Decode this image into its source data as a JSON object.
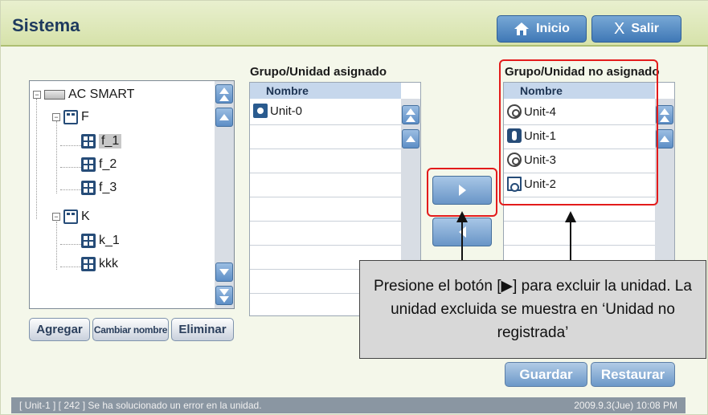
{
  "header": {
    "title": "Sistema",
    "home_label": "Inicio",
    "exit_label": "Salir",
    "exit_glyph": "X"
  },
  "tree": {
    "root": "AC SMART",
    "groups": [
      {
        "name": "F",
        "units": [
          "f_1",
          "f_2",
          "f_3"
        ]
      },
      {
        "name": "K",
        "units": [
          "k_1",
          "kkk"
        ]
      }
    ],
    "selected": "f_1"
  },
  "tree_buttons": {
    "add": "Agregar",
    "rename": "Cambiar nombre",
    "delete": "Eliminar"
  },
  "assigned": {
    "title": "Grupo/Unidad asignado",
    "column": "Nombre",
    "items": [
      {
        "name": "Unit-0",
        "icon": "home-unit-icon"
      }
    ]
  },
  "unassigned": {
    "title": "Grupo/Unidad no asignado",
    "column": "Nombre",
    "items": [
      {
        "name": "Unit-4",
        "icon": "gear-unit-icon"
      },
      {
        "name": "Unit-1",
        "icon": "cassette-unit-icon"
      },
      {
        "name": "Unit-3",
        "icon": "gear-unit-icon"
      },
      {
        "name": "Unit-2",
        "icon": "duct-unit-icon"
      }
    ]
  },
  "callout": {
    "text": "Presione el botón [▶] para excluir la unidad. La unidad excluida se muestra en ‘Unidad no registrada’"
  },
  "actions": {
    "save": "Guardar",
    "restore": "Restaurar"
  },
  "status": {
    "message": "[ Unit-1 ] [ 242 ] Se ha solucionado un error en la unidad.",
    "datetime": "2009.9.3(Jue)  10:08 PM"
  },
  "colors": {
    "header_bg": "#d6e2aa",
    "title": "#1e3a5e",
    "button_blue": "#3f78b6",
    "highlight_red": "#e31b1b",
    "status_bg": "#8a96a2"
  }
}
